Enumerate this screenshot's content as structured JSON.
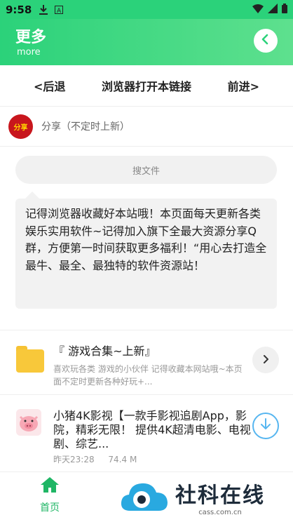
{
  "status_bar": {
    "time": "9:58"
  },
  "header": {
    "title": "更多",
    "subtitle": "more"
  },
  "nav": {
    "back_label": "<后退",
    "open_browser_label": "浏览器打开本链接",
    "forward_label": "前进>"
  },
  "share": {
    "logo_text": "分享",
    "label": "分享（不定时上新）"
  },
  "search": {
    "placeholder": "搜文件"
  },
  "notice": {
    "text": "记得浏览器收藏好本站哦！本页面每天更新各类娱乐实用软件~记得加入旗下全最大资源分享Q群，方便第一时间获取更多福利！“用心去打造全最牛、最全、最独特的软件资源站！"
  },
  "items": [
    {
      "title": "『 游戏合集~上新』",
      "description": "喜欢玩各类 游戏的小伙伴 记得收藏本网站哦~本页面不定时更新各种好玩+..."
    },
    {
      "title": "小猪4K影视【一款手影视追剧App，影院，精彩无限！ 提供4K超清电影、电视剧、综艺...",
      "date": "昨天23:28",
      "size": "74.4 M"
    }
  ],
  "tabbar": {
    "home_label": "首页"
  },
  "watermark": {
    "name": "社科在线",
    "site": "cass.com.cn"
  },
  "colors": {
    "accent": "#2bd27a",
    "home_green": "#1fb665",
    "download_blue": "#57b6f0"
  }
}
